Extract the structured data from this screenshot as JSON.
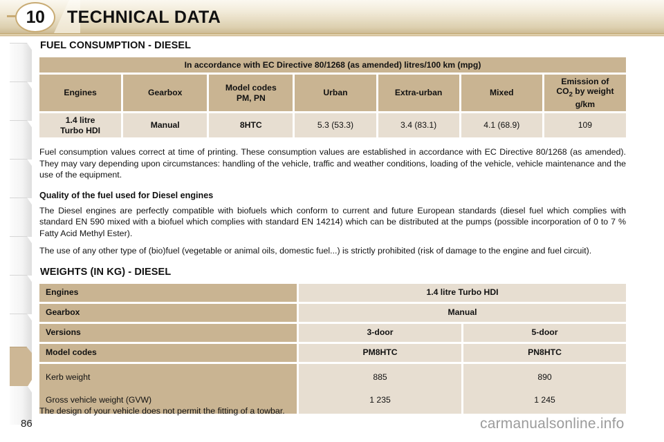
{
  "header": {
    "chapter_number": "10",
    "title": "TECHNICAL DATA"
  },
  "fuel_section": {
    "title": "FUEL CONSUMPTION - DIESEL",
    "table": {
      "caption": "In accordance with EC Directive 80/1268 (as amended) litres/100 km (mpg)",
      "headers": {
        "engines": "Engines",
        "gearbox": "Gearbox",
        "model_codes_line1": "Model codes",
        "model_codes_line2": "PM, PN",
        "urban": "Urban",
        "extra_urban": "Extra-urban",
        "mixed": "Mixed",
        "co2_line1": "Emission of",
        "co2_line2_pre": "CO",
        "co2_line2_sub": "2",
        "co2_line2_post": " by weight",
        "co2_line3": "g/km"
      },
      "row": {
        "engine_line1": "1.4 litre",
        "engine_line2": "Turbo HDI",
        "gearbox": "Manual",
        "model_code": "8HTC",
        "urban": "5.3 (53.3)",
        "extra_urban": "3.4 (83.1)",
        "mixed": "4.1 (68.9)",
        "co2": "109"
      }
    },
    "note": "Fuel consumption values correct at time of printing. These consumption values are established in accordance with EC Directive 80/1268 (as amended). They may vary depending upon circumstances: handling of the vehicle, traffic and weather conditions, loading of the vehicle, vehicle maintenance and the use of the equipment."
  },
  "quality_section": {
    "heading": "Quality of the fuel used for Diesel engines",
    "paragraph_1": "The Diesel engines are perfectly compatible with biofuels which conform to current and future European standards (diesel fuel which complies with standard EN 590 mixed with a biofuel which complies with standard EN 14214) which can be distributed at the pumps (possible incorporation of 0 to 7 % Fatty Acid Methyl Ester).",
    "paragraph_2": "The use of any other type of (bio)fuel (vegetable or animal oils, domestic fuel...) is strictly prohibited (risk of damage to the engine and fuel circuit)."
  },
  "weights_section": {
    "title": "WEIGHTS (IN KG) - DIESEL",
    "rows": {
      "engines_label": "Engines",
      "engines_value": "1.4 litre Turbo HDI",
      "gearbox_label": "Gearbox",
      "gearbox_value": "Manual",
      "versions_label": "Versions",
      "versions_3door": "3-door",
      "versions_5door": "5-door",
      "model_codes_label": "Model codes",
      "model_code_3door": "PM8HTC",
      "model_code_5door": "PN8HTC",
      "kerb_weight_label": "Kerb weight",
      "kerb_weight_3door": "885",
      "kerb_weight_5door": "890",
      "gvw_label": "Gross vehicle weight (GVW)",
      "gvw_3door": "1 235",
      "gvw_5door": "1 245"
    }
  },
  "footer": {
    "note": "The design of your vehicle does not permit the fitting of a towbar.",
    "page_number": "86",
    "watermark": "carmanualsonline.info"
  }
}
